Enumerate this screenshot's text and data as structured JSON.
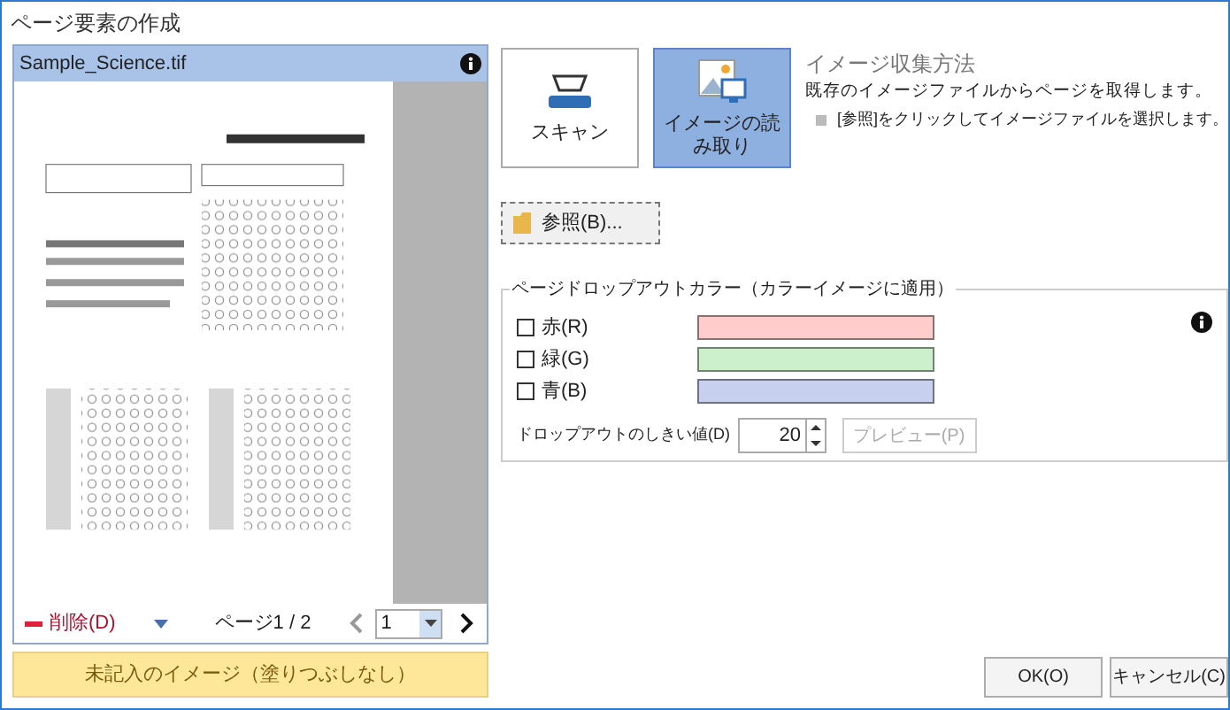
{
  "window": {
    "title": "ページ要素の作成"
  },
  "preview": {
    "file_name": "Sample_Science.tif",
    "delete_label": "削除(D)",
    "page_label": "ページ1 / 2",
    "page_select": "1",
    "blank_image_button": "未記入のイメージ（塗りつぶしなし）"
  },
  "methods": [
    {
      "label": "スキャン",
      "selected": false,
      "kind": "scan"
    },
    {
      "label": "イメージの読み取り",
      "selected": true,
      "kind": "file"
    }
  ],
  "method_info": {
    "title": "イメージ収集方法",
    "description": "既存のイメージファイルからページを取得します。",
    "hint": "[参照]をクリックしてイメージファイルを選択します。"
  },
  "browse_button": "参照(B)...",
  "dropout": {
    "legend": "ページドロップアウトカラー（カラーイメージに適用）",
    "colors": [
      {
        "label": "赤(R)",
        "checked": false,
        "color": "#ffcccc"
      },
      {
        "label": "緑(G)",
        "checked": false,
        "color": "#ccf0cc"
      },
      {
        "label": "青(B)",
        "checked": false,
        "color": "#c8d0f0"
      }
    ],
    "threshold_label": "ドロップアウトのしきい値(D)",
    "threshold": "20",
    "preview_button": "プレビュー(P)",
    "preview_disabled": true
  },
  "buttons": [
    "OK(O)",
    "キャンセル(C)"
  ]
}
